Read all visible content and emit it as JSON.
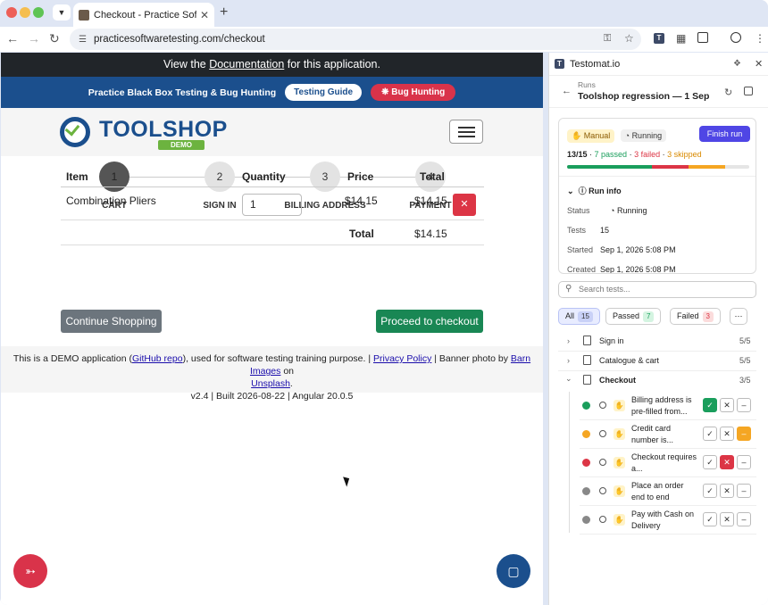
{
  "browser": {
    "tab_title": "Checkout - Practice Software",
    "url": "practicesoftwaretesting.com/checkout"
  },
  "site": {
    "banner_prefix": "View the ",
    "banner_link": "Documentation",
    "banner_suffix": " for this application.",
    "bluebar_text": "Practice Black Box Testing & Bug Hunting",
    "testing_guide": "Testing Guide",
    "bug_hunting": "Bug Hunting",
    "logo_word": "TOOLSHOP",
    "logo_demo": "DEMO",
    "steps": [
      {
        "num": "1",
        "label": "CART"
      },
      {
        "num": "2",
        "label": "SIGN IN"
      },
      {
        "num": "3",
        "label": "BILLING ADDRESS"
      },
      {
        "num": "4",
        "label": "PAYMENT"
      }
    ],
    "table": {
      "headers": {
        "item": "Item",
        "quantity": "Quantity",
        "price": "Price",
        "total": "Total"
      },
      "row": {
        "item": "Combination Pliers",
        "quantity": "1",
        "price": "$14.15",
        "total": "$14.15"
      },
      "total_label": "Total",
      "total_value": "$14.15"
    },
    "continue_shopping": "Continue Shopping",
    "proceed_checkout": "Proceed to checkout",
    "footer": {
      "t1": "This is a DEMO application (",
      "github": "GitHub repo",
      "t2": "), used for software testing training purpose. | ",
      "privacy": "Privacy Policy",
      "t3": " | Banner photo by ",
      "barn": "Barn Images",
      "t4": " on ",
      "unsplash": "Unsplash",
      "t5": ".",
      "version": "v2.4 | Built 2026-08-22 | Angular 20.0.5"
    }
  },
  "panel": {
    "title": "Testomat.io",
    "runs_label": "Runs",
    "run_name": "Toolshop regression — 1 Sep",
    "manual": "Manual",
    "running": "Running",
    "finish_run": "Finish run",
    "progress_count": "13/15",
    "passed_text": "7 passed",
    "failed_text": "3 failed",
    "skipped_text": "3 skipped",
    "progress": {
      "passed": 7,
      "failed": 3,
      "skipped": 3,
      "total": 15
    },
    "run_info": "Run info",
    "info": {
      "status_label": "Status",
      "status_value": "Running",
      "tests_label": "Tests",
      "tests_value": "15",
      "started_label": "Started",
      "started_value": "Sep 1, 2026 5:08 PM",
      "created_label": "Created",
      "created_value": "Sep 1, 2026 5:08 PM"
    },
    "search_placeholder": "Search tests...",
    "filters": {
      "all": "All",
      "all_count": "15",
      "passed": "Passed",
      "passed_count": "7",
      "failed": "Failed",
      "failed_count": "3"
    },
    "suites": [
      {
        "name": "Sign in",
        "count": "5/5"
      },
      {
        "name": "Catalogue & cart",
        "count": "5/5"
      },
      {
        "name": "Checkout",
        "count": "3/5"
      }
    ],
    "tests": [
      {
        "title": "Billing address is pre-filled from...",
        "status": "passed"
      },
      {
        "title": "Credit card number is...",
        "status": "skipped"
      },
      {
        "title": "Checkout requires a...",
        "status": "failed"
      },
      {
        "title": "Place an order end to end",
        "status": "pending"
      },
      {
        "title": "Pay with Cash on Delivery",
        "status": "pending"
      }
    ],
    "colors": {
      "passed": "#1a9e5c",
      "failed": "#dc3545",
      "skipped": "#f5a623",
      "pending": "#888888",
      "accent": "#4f46e5"
    }
  }
}
